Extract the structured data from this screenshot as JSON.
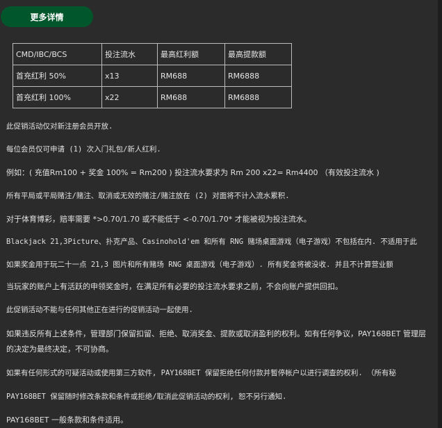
{
  "button": {
    "label": "更多详情"
  },
  "table": {
    "headers": [
      "CMD/IBC/BCS",
      "投注流水",
      "最高红利额",
      "最高提款额"
    ],
    "rows": [
      [
        "首充红利 50%",
        "x13",
        "RM688",
        "RM6888"
      ],
      [
        "首充红利 100%",
        "x22",
        "RM688",
        "RM6888"
      ]
    ]
  },
  "terms": [
    "此促销活动仅对新注册会员开放.",
    "每位会员仅可申请 (1) 次入门礼包/新人红利.",
    "例如：( 充值Rm100 + 奖金 100% = Rm200 ) 投注流水要求为 Rm 200 x22= Rm4400 （有效投注流水 )",
    "所有平局或平局赌注/赌注、取消或无效的赌注/赌注放在 (2) 对面将不计入流水累积.",
    "对于体育博彩，赔率需要 *>0.70/1.70 或不能低于 <-0.70/1.70* 才能被视为投注流水。",
    "Blackjack 21,3Picture、扑克产品、Casinohold'em 和所有 RNG 赌场桌面游戏（电子游戏）不包括在内. 不适用于此",
    "如果奖金用于玩二十一点 21,3 图片和所有赌场 RNG 桌面游戏（电子游戏）. 所有奖金将被没收. 并且不计算营业额",
    "当玩家的账户上有活跃的申领奖金时，在满足所有必要的投注流水要求之前，不会向账户提供回扣。",
    "此促销活动不能与任何其他正在进行的促销活动一起使用.",
    "如果违反所有上述条件，管理部门保留扣留、拒绝、取消奖金、提款或取消盈利的权利。如有任何争议，PAY168BET 管理层的决定为最终决定，不可协商。",
    "如果有任何形式的可疑活动或使用第三方软件, PAY168BET 保留拒绝任何付款并暂停帐户以进行调查的权利. （所有秘",
    "PAY168BET 保留随时修改条款和条件或拒绝/取消此促销活动的权利, 恕不另行通知.",
    "PAY168BET 一般条款和条件适用。"
  ]
}
